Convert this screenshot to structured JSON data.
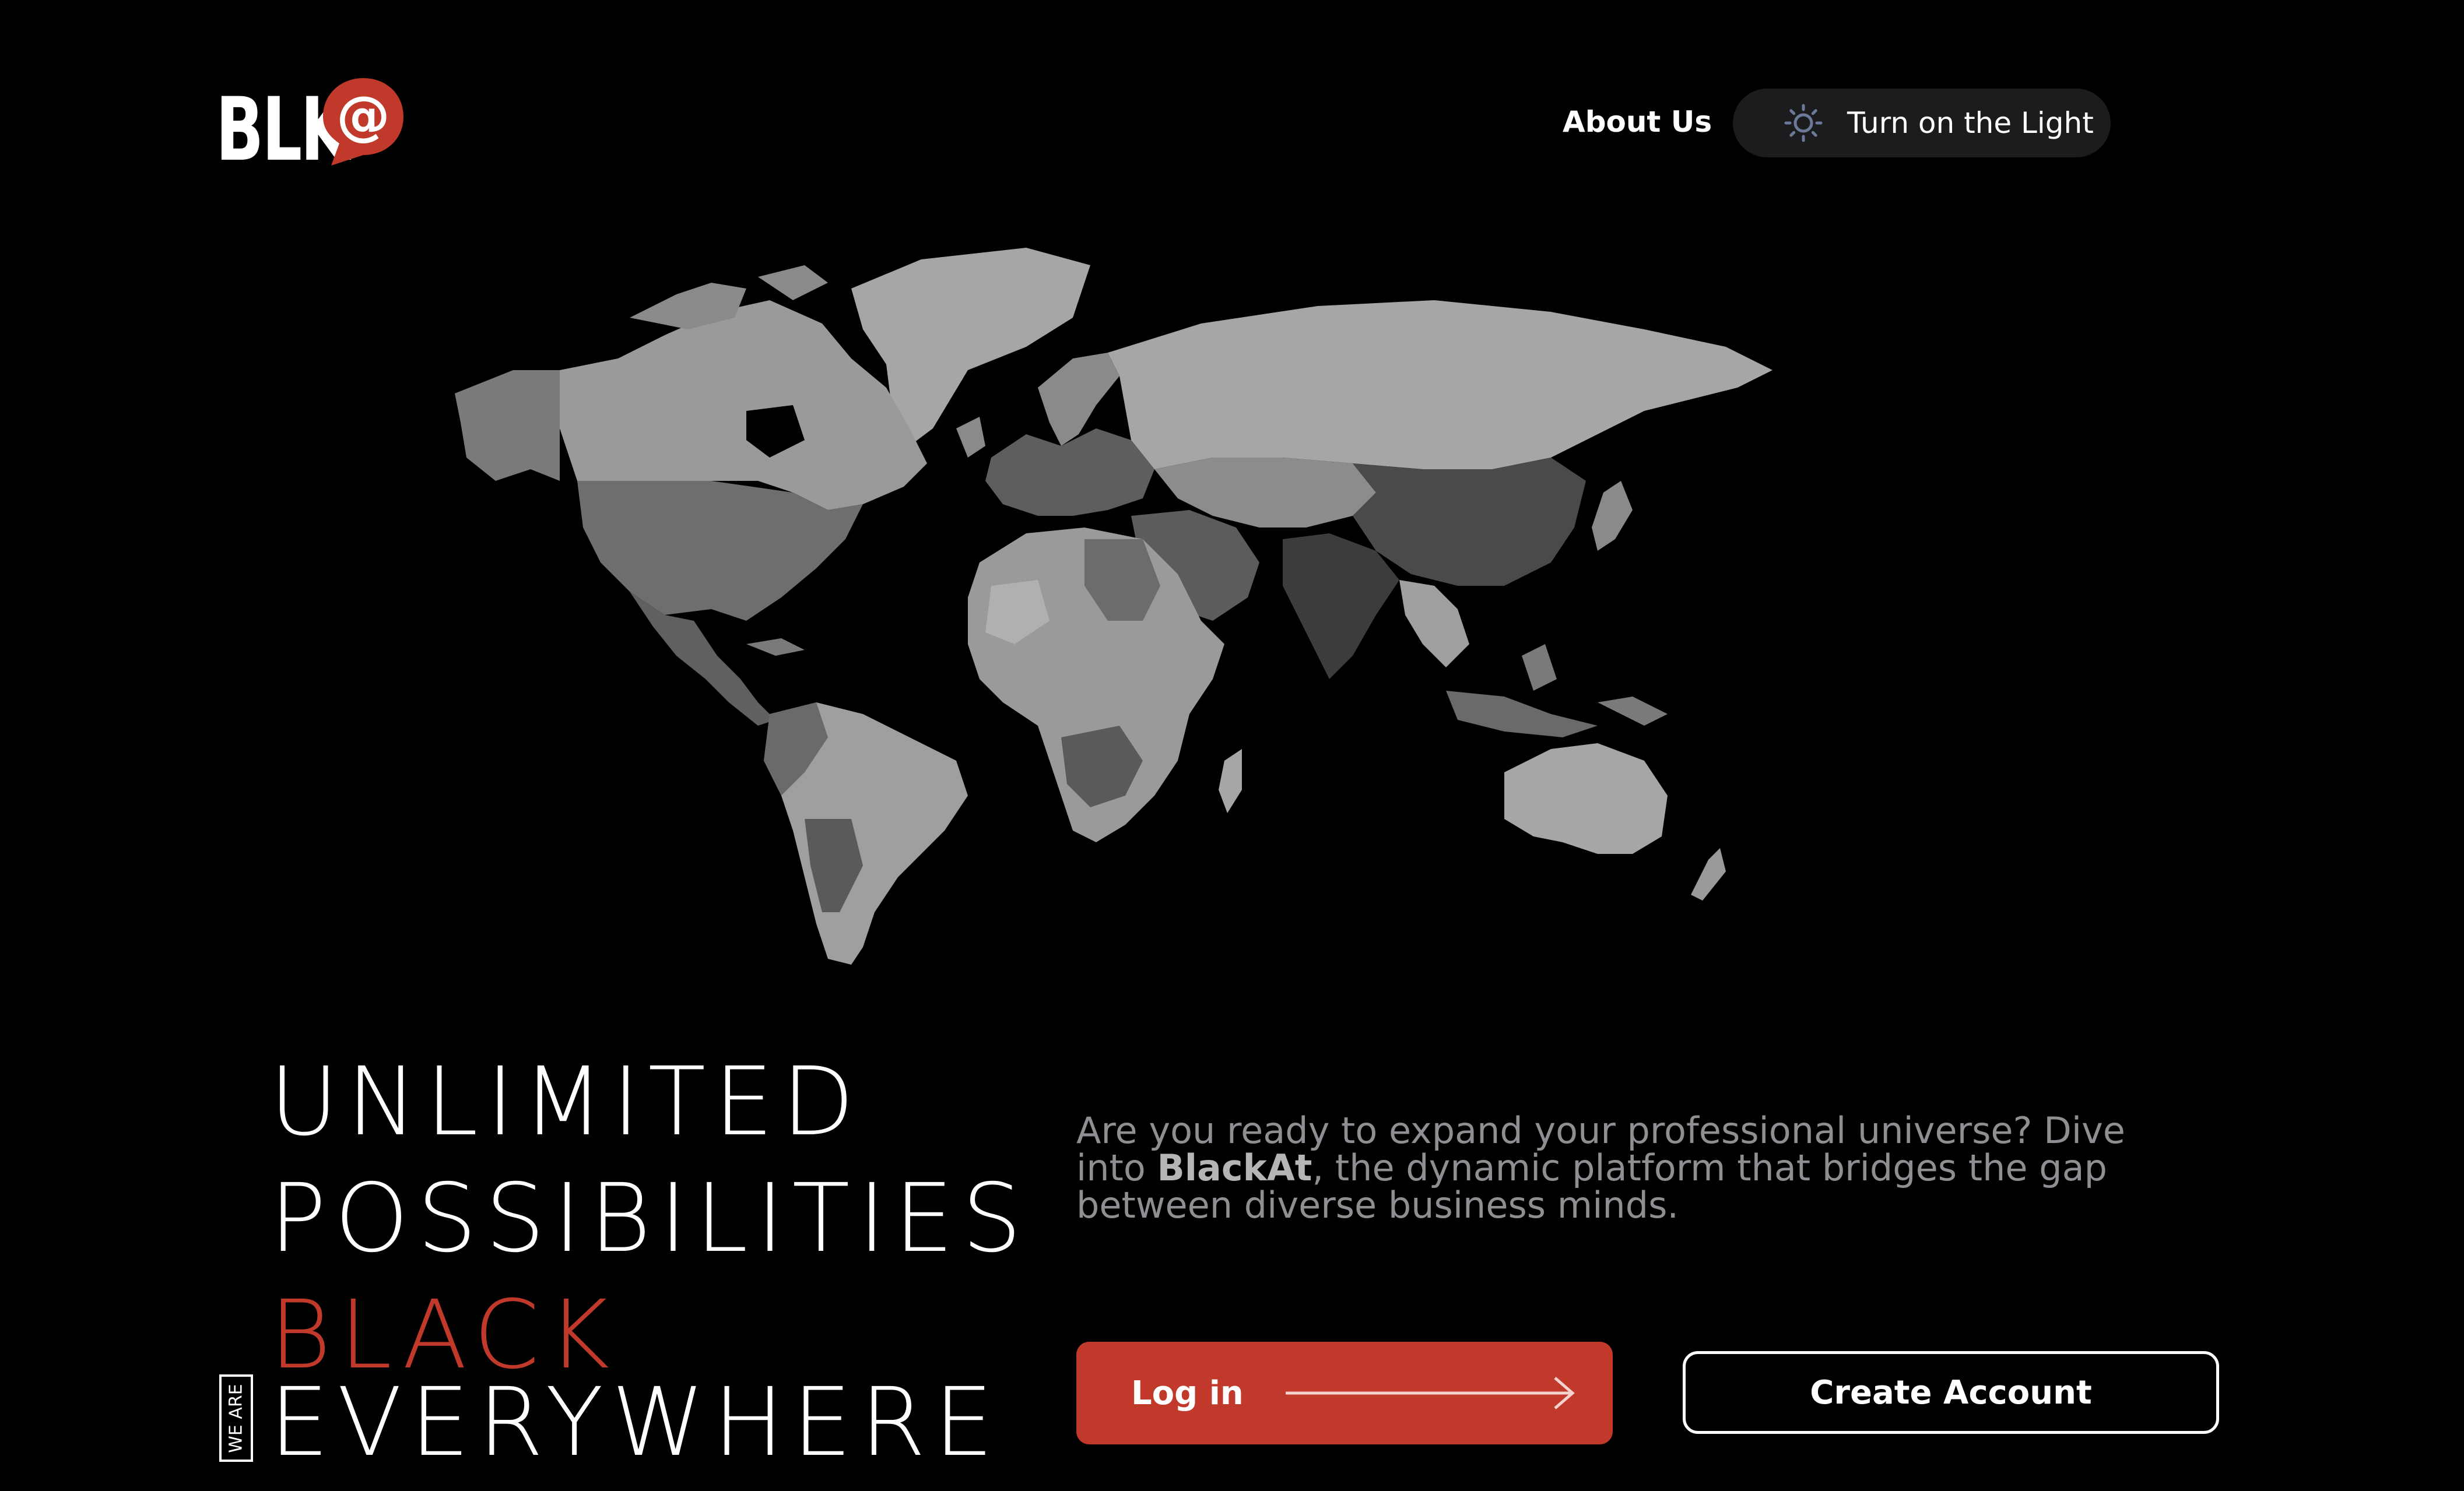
{
  "brand": {
    "logo_text": "BLK",
    "logo_symbol": "@",
    "accent_color": "#c0392b"
  },
  "nav": {
    "about_label": "About Us",
    "theme_toggle_label": "Turn on the Light",
    "theme_icon": "sun-icon"
  },
  "hero": {
    "headline_line1": "UNLIMITED",
    "headline_line2": "POSSIBILITIES",
    "headline_line3": "BLACK",
    "headline_line4": "EVERYWHERE",
    "we_are_label": "WE ARE",
    "description_before": "Are you ready to expand your professional universe? Dive into ",
    "description_brand": "BlackAt",
    "description_after": ", the dynamic platform that bridges the gap between diverse business minds."
  },
  "actions": {
    "login_label": "Log in",
    "create_account_label": "Create Account"
  }
}
